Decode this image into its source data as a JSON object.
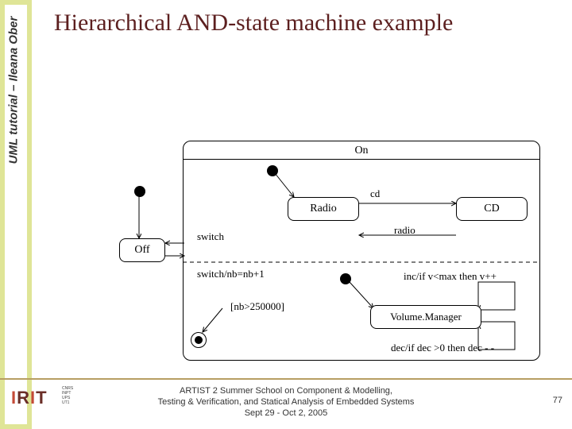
{
  "sidebar": {
    "text": "UML tutorial – Ileana Ober"
  },
  "title": "Hierarchical AND-state machine example",
  "states": {
    "on": "On",
    "off": "Off",
    "radio": "Radio",
    "cd": "CD",
    "volume": "Volume.Manager"
  },
  "transitions": {
    "cd": "cd",
    "radio": "radio",
    "switch": "switch",
    "switch_nb": "switch/nb=nb+1",
    "nb_guard": "[nb>250000]",
    "inc": "inc/if v<max then v++",
    "dec": "dec/if dec >0 then dec - -"
  },
  "footer": {
    "l1": "ARTIST 2 Summer School on Component & Modelling,",
    "l2": "Testing & Verification, and Statical Analysis of Embedded Systems",
    "l3": "Sept 29 - Oct 2, 2005"
  },
  "logo": {
    "brand": "IRIT",
    "lines": [
      "CNRS",
      "INPT",
      "UPS",
      "UT1"
    ]
  },
  "slide_number": "77"
}
